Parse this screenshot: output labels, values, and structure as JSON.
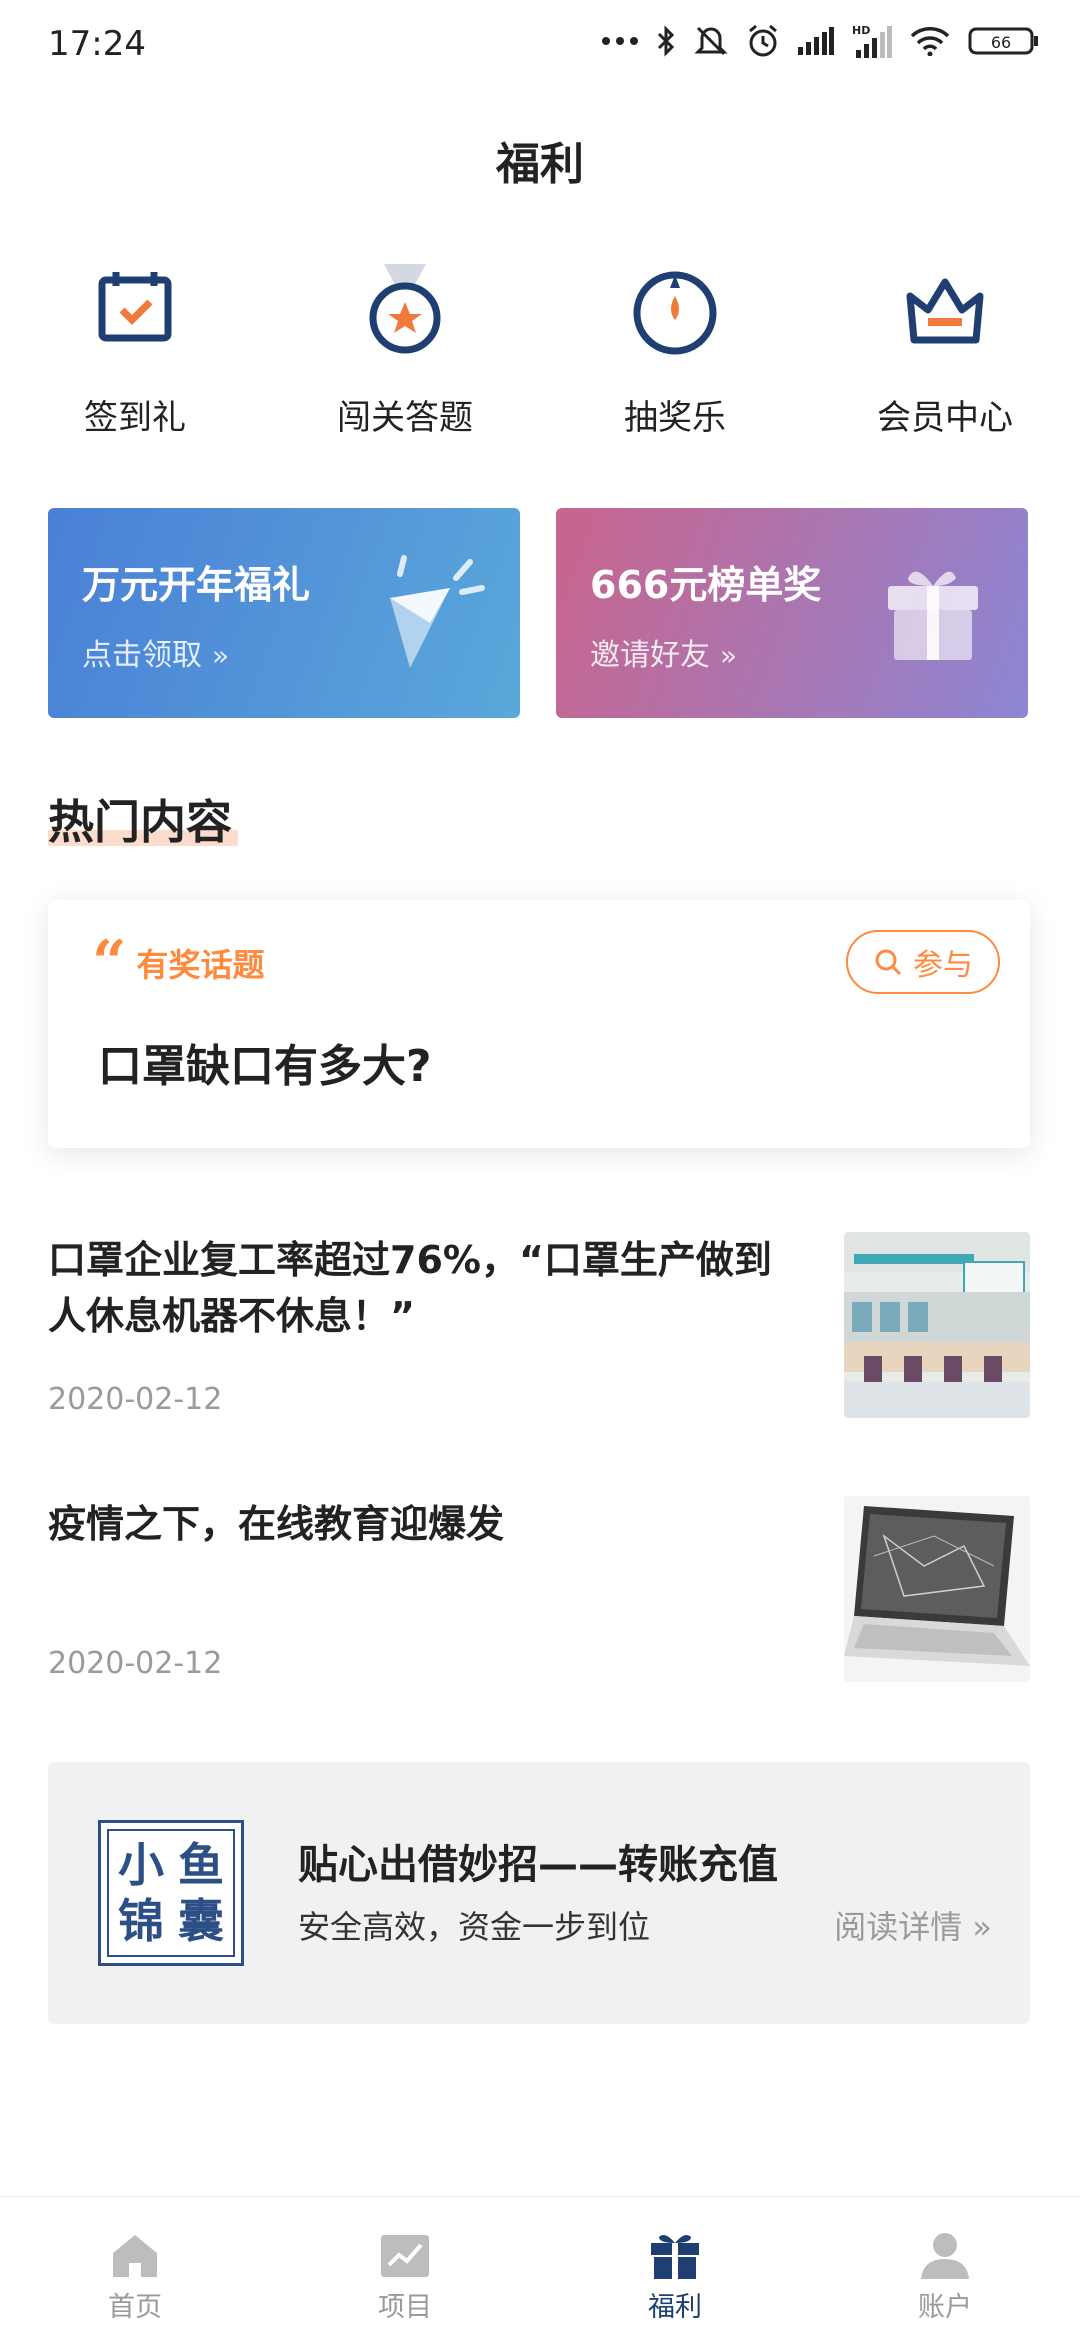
{
  "status_bar": {
    "time": "17:24",
    "battery": "66",
    "icons": [
      "dots-icon",
      "bluetooth-icon",
      "mute-icon",
      "alarm-icon",
      "signal-icon",
      "hd-signal-icon",
      "wifi-icon",
      "battery-icon"
    ]
  },
  "header": {
    "title": "福利"
  },
  "features": [
    {
      "label": "签到礼",
      "icon": "calendar-check-icon"
    },
    {
      "label": "闯关答题",
      "icon": "medal-icon"
    },
    {
      "label": "抽奖乐",
      "icon": "wheel-icon"
    },
    {
      "label": "会员中心",
      "icon": "crown-icon"
    }
  ],
  "banners": [
    {
      "title": "万元开年福礼",
      "sub": "点击领取",
      "icon": "party-horn-icon",
      "colors": [
        "#4a7fd6",
        "#5aa8da"
      ]
    },
    {
      "title": "666元榜单奖",
      "sub": "邀请好友",
      "icon": "gift-box-icon",
      "colors": [
        "#c9648c",
        "#8c86d4"
      ]
    }
  ],
  "hot": {
    "title": "热门内容",
    "topic": {
      "tag": "有奖话题",
      "join_label": "参与",
      "question": "口罩缺口有多大?"
    },
    "news": [
      {
        "title": "口罩企业复工率超过76%，“口罩生产做到人休息机器不休息！”",
        "date": "2020-02-12",
        "image": "clinic-lobby-photo"
      },
      {
        "title": "疫情之下，在线教育迎爆发",
        "date": "2020-02-12",
        "image": "laptop-photo"
      }
    ]
  },
  "ad": {
    "logo_chars": [
      "小",
      "鱼",
      "锦",
      "囊"
    ],
    "title": "贴心出借妙招——转账充值",
    "sub": "安全高效，资金一步到位",
    "more": "阅读详情"
  },
  "tabbar": {
    "items": [
      {
        "label": "首页",
        "icon": "home-icon",
        "active": false
      },
      {
        "label": "项目",
        "icon": "chart-icon",
        "active": false
      },
      {
        "label": "福利",
        "icon": "gift-icon",
        "active": true
      },
      {
        "label": "账户",
        "icon": "user-icon",
        "active": false
      }
    ]
  },
  "colors": {
    "accent": "#ff8a3d",
    "brand": "#1f3f72",
    "muted": "#9a9a9a"
  }
}
